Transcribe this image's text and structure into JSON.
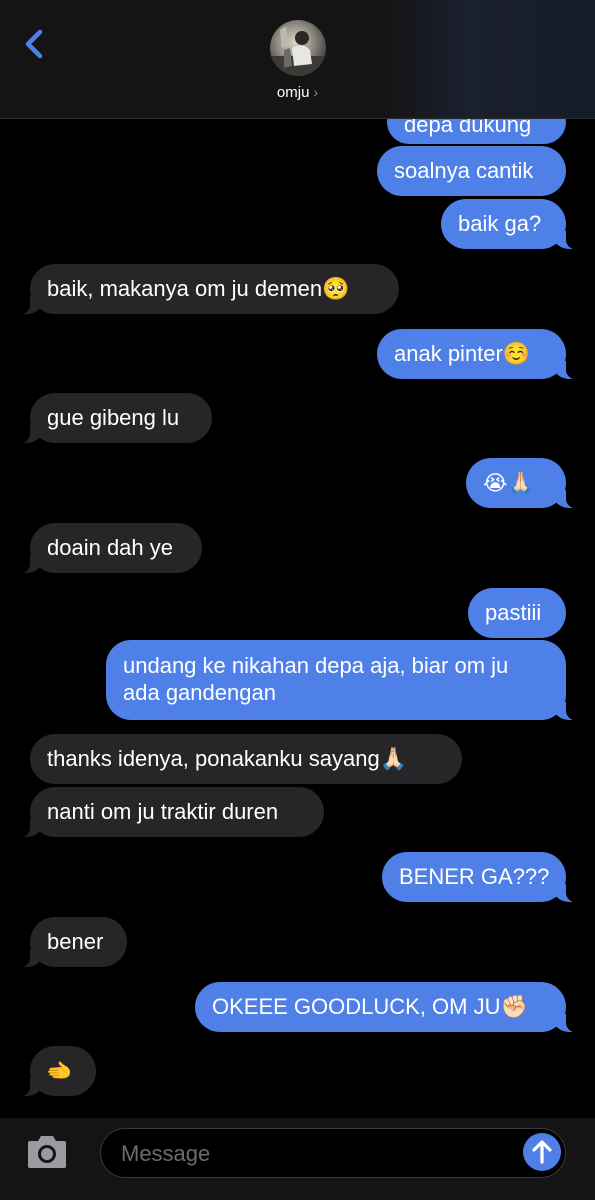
{
  "header": {
    "contact_name": "omju",
    "chevron": "›",
    "back_icon": "chevron-left-icon",
    "accent_color": "#4f80e8"
  },
  "messages": [
    {
      "side": "out",
      "text": "depa dukung"
    },
    {
      "side": "out",
      "text": "soalnya cantik"
    },
    {
      "side": "out",
      "text": "baik ga?"
    },
    {
      "side": "in",
      "text": "baik, makanya om ju demen🥺"
    },
    {
      "side": "out",
      "text": "anak pinter☺️"
    },
    {
      "side": "in",
      "text": "gue gibeng lu"
    },
    {
      "side": "out",
      "text": "😭🙏🏻"
    },
    {
      "side": "in",
      "text": "doain dah ye"
    },
    {
      "side": "out",
      "text": "pastiii"
    },
    {
      "side": "out",
      "text": "undang ke nikahan depa aja, biar om ju ada gandengan"
    },
    {
      "side": "in",
      "text": "thanks idenya, ponakanku sayang🙏🏻"
    },
    {
      "side": "in",
      "text": "nanti om ju traktir duren"
    },
    {
      "side": "out",
      "text": "BENER GA???"
    },
    {
      "side": "in",
      "text": "bener"
    },
    {
      "side": "out",
      "text": "OKEEE GOODLUCK, OM JU✊🏻"
    },
    {
      "side": "in",
      "text": "🫲"
    }
  ],
  "composer": {
    "placeholder": "Message",
    "camera_icon": "camera-icon",
    "send_icon": "arrow-up-icon"
  },
  "colors": {
    "outgoing_bubble": "#4f80e8",
    "incoming_bubble": "#262629",
    "background": "#000000"
  }
}
